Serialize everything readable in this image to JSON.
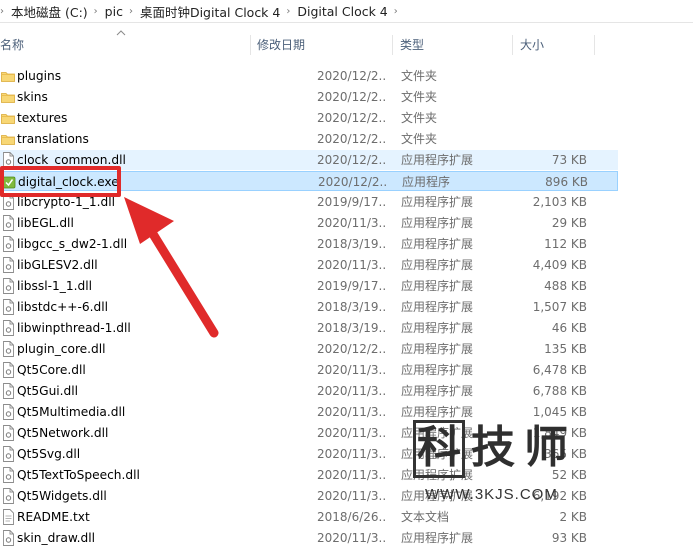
{
  "breadcrumb": [
    "本地磁盘 (C:)",
    "pic",
    "桌面时钟Digital Clock 4",
    "Digital Clock 4"
  ],
  "columns": {
    "name": "名称",
    "date": "修改日期",
    "type": "类型",
    "size": "大小"
  },
  "files": [
    {
      "name": "plugins",
      "date": "2020/12/2...",
      "type": "文件夹",
      "size": "",
      "kind": "folder"
    },
    {
      "name": "skins",
      "date": "2020/12/2...",
      "type": "文件夹",
      "size": "",
      "kind": "folder"
    },
    {
      "name": "textures",
      "date": "2020/12/2...",
      "type": "文件夹",
      "size": "",
      "kind": "folder"
    },
    {
      "name": "translations",
      "date": "2020/12/2...",
      "type": "文件夹",
      "size": "",
      "kind": "folder"
    },
    {
      "name": "clock_common.dll",
      "date": "2020/12/2...",
      "type": "应用程序扩展",
      "size": "73 KB",
      "kind": "dll"
    },
    {
      "name": "digital_clock.exe",
      "date": "2020/12/2...",
      "type": "应用程序",
      "size": "896 KB",
      "kind": "exe"
    },
    {
      "name": "libcrypto-1_1.dll",
      "date": "2019/9/17...",
      "type": "应用程序扩展",
      "size": "2,103 KB",
      "kind": "dll"
    },
    {
      "name": "libEGL.dll",
      "date": "2020/11/3...",
      "type": "应用程序扩展",
      "size": "29 KB",
      "kind": "dll"
    },
    {
      "name": "libgcc_s_dw2-1.dll",
      "date": "2018/3/19...",
      "type": "应用程序扩展",
      "size": "112 KB",
      "kind": "dll"
    },
    {
      "name": "libGLESV2.dll",
      "date": "2020/11/3...",
      "type": "应用程序扩展",
      "size": "4,409 KB",
      "kind": "dll"
    },
    {
      "name": "libssl-1_1.dll",
      "date": "2019/9/17...",
      "type": "应用程序扩展",
      "size": "488 KB",
      "kind": "dll"
    },
    {
      "name": "libstdc++-6.dll",
      "date": "2018/3/19...",
      "type": "应用程序扩展",
      "size": "1,507 KB",
      "kind": "dll"
    },
    {
      "name": "libwinpthread-1.dll",
      "date": "2018/3/19...",
      "type": "应用程序扩展",
      "size": "46 KB",
      "kind": "dll"
    },
    {
      "name": "plugin_core.dll",
      "date": "2020/12/2...",
      "type": "应用程序扩展",
      "size": "135 KB",
      "kind": "dll"
    },
    {
      "name": "Qt5Core.dll",
      "date": "2020/11/3...",
      "type": "应用程序扩展",
      "size": "6,478 KB",
      "kind": "dll"
    },
    {
      "name": "Qt5Gui.dll",
      "date": "2020/11/3...",
      "type": "应用程序扩展",
      "size": "6,788 KB",
      "kind": "dll"
    },
    {
      "name": "Qt5Multimedia.dll",
      "date": "2020/11/3...",
      "type": "应用程序扩展",
      "size": "1,045 KB",
      "kind": "dll"
    },
    {
      "name": "Qt5Network.dll",
      "date": "2020/11/3...",
      "type": "应用程序扩展",
      "size": "1,849 KB",
      "kind": "dll"
    },
    {
      "name": "Qt5Svg.dll",
      "date": "2020/11/3...",
      "type": "应用程序扩展",
      "size": "365 KB",
      "kind": "dll"
    },
    {
      "name": "Qt5TextToSpeech.dll",
      "date": "2020/11/3...",
      "type": "应用程序扩展",
      "size": "52 KB",
      "kind": "dll"
    },
    {
      "name": "Qt5Widgets.dll",
      "date": "2020/11/3...",
      "type": "应用程序扩展",
      "size": "6,192 KB",
      "kind": "dll"
    },
    {
      "name": "README.txt",
      "date": "2018/6/26...",
      "type": "文本文档",
      "size": "2 KB",
      "kind": "txt"
    },
    {
      "name": "skin_draw.dll",
      "date": "2020/11/3...",
      "type": "应用程序扩展",
      "size": "93 KB",
      "kind": "dll"
    }
  ],
  "hover_row": "clock_common.dll",
  "selected_row": "digital_clock.exe",
  "annotation": {
    "box_color": "#e02a2a",
    "arrow_color": "#e02a2a"
  },
  "watermark": {
    "chars": [
      "科",
      "技",
      "师"
    ],
    "url": "WWW.3KJS.COM"
  }
}
